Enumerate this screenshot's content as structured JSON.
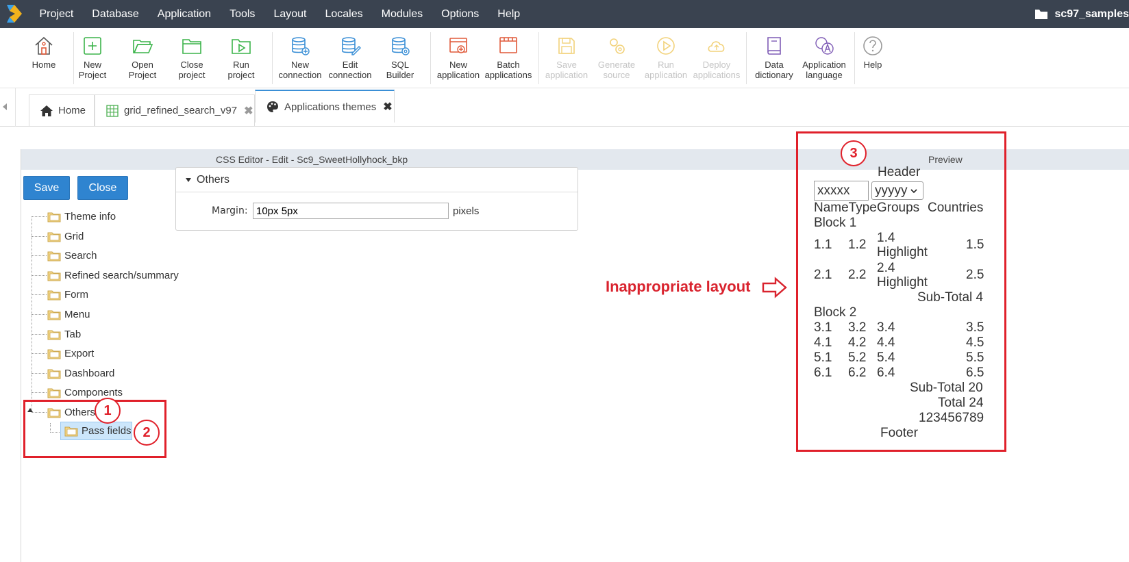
{
  "menubar": {
    "items": [
      "Project",
      "Database",
      "Application",
      "Tools",
      "Layout",
      "Locales",
      "Modules",
      "Options",
      "Help"
    ],
    "project_name": "sc97_samples"
  },
  "toolbar": {
    "home": "Home",
    "new_project": [
      "New",
      "Project"
    ],
    "open_project": [
      "Open",
      "Project"
    ],
    "close_project": [
      "Close",
      "project"
    ],
    "run_project": [
      "Run",
      "project"
    ],
    "new_connection": [
      "New",
      "connection"
    ],
    "edit_connection": [
      "Edit",
      "connection"
    ],
    "sql_builder": [
      "SQL",
      "Builder"
    ],
    "new_application": [
      "New",
      "application"
    ],
    "batch_applications": [
      "Batch",
      "applications"
    ],
    "save_application": [
      "Save",
      "application"
    ],
    "generate_source": [
      "Generate",
      "source"
    ],
    "run_application": [
      "Run",
      "application"
    ],
    "deploy_applications": [
      "Deploy",
      "applications"
    ],
    "data_dictionary": [
      "Data",
      "dictionary"
    ],
    "application_language": [
      "Application",
      "language"
    ],
    "help": "Help"
  },
  "tabs": [
    {
      "label": "Home"
    },
    {
      "label": "grid_refined_search_v97"
    },
    {
      "label": "Applications themes"
    }
  ],
  "editor": {
    "title": "CSS Editor - Edit - Sc9_SweetHollyhock_bkp",
    "preview_label": "Preview",
    "save_label": "Save",
    "close_label": "Close"
  },
  "tree": {
    "items": [
      "Theme info",
      "Grid",
      "Search",
      "Refined search/summary",
      "Form",
      "Menu",
      "Tab",
      "Export",
      "Dashboard",
      "Components",
      "Others"
    ],
    "child": "Pass fields"
  },
  "panel": {
    "title": "Others",
    "margin_label": "Margin:",
    "margin_value": "10px 5px",
    "margin_unit": "pixels"
  },
  "annotations": {
    "badge1": "1",
    "badge2": "2",
    "badge3": "3",
    "note": "Inappropriate layout"
  },
  "preview": {
    "header": "Header",
    "input": "xxxxx",
    "select": "yyyyy",
    "columns": "NameTypeGroups",
    "countries": "Countries",
    "block1": "Block 1",
    "r1": [
      "1.1",
      "1.2",
      "1.4",
      "Highlight",
      "1.5"
    ],
    "r2": [
      "2.1",
      "2.2",
      "2.4",
      "Highlight",
      "2.5"
    ],
    "subtotal1": "Sub-Total 4",
    "block2": "Block 2",
    "rows": [
      [
        "3.1",
        "3.2",
        "3.4",
        "3.5"
      ],
      [
        "4.1",
        "4.2",
        "4.4",
        "4.5"
      ],
      [
        "5.1",
        "5.2",
        "5.4",
        "5.5"
      ],
      [
        "6.1",
        "6.2",
        "6.4",
        "6.5"
      ]
    ],
    "subtotal2": "Sub-Total 20",
    "total": "Total 24",
    "digits": "123456789",
    "footer": "Footer"
  },
  "colors": {
    "menubar_bg": "#3a4350",
    "accent_blue": "#2f84d0",
    "annotation_red": "#e0202a"
  }
}
